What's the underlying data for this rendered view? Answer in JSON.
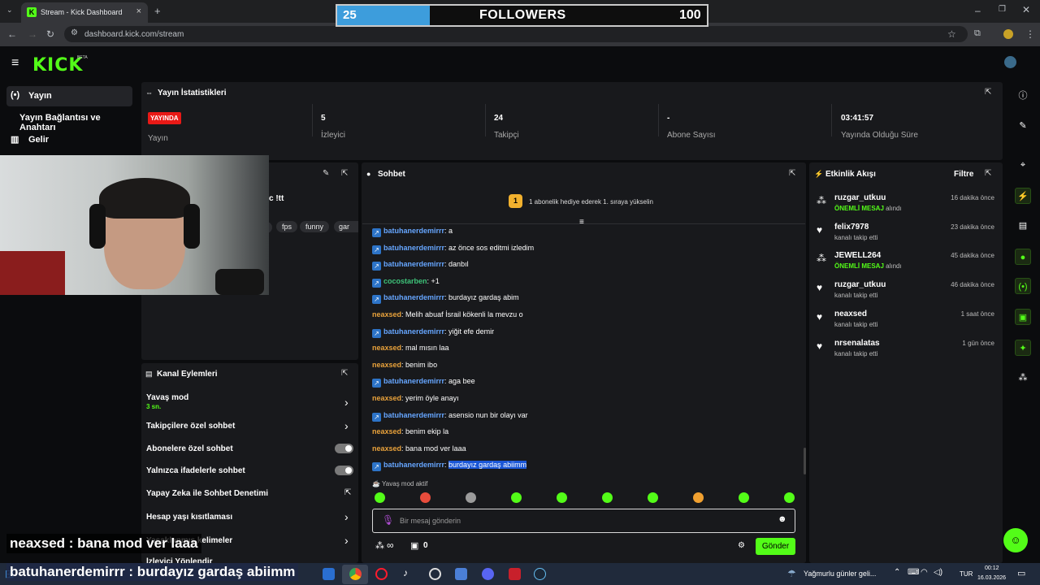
{
  "browser": {
    "tab_title": "Stream - Kick Dashboard",
    "url": "dashboard.kick.com/stream"
  },
  "followers_goal": {
    "current": "25",
    "title": "FOLLOWERS",
    "goal": "100",
    "progress": 0.25,
    "fill_color": "#3d9ddc"
  },
  "brand": {
    "logo": "KICK",
    "beta": "BETA",
    "accent": "#53fc18"
  },
  "sidebar": {
    "items": [
      {
        "label": "Yayın",
        "icon": "broadcast-icon"
      },
      {
        "label": "Yayın Bağlantısı ve Anahtarı",
        "icon": ""
      },
      {
        "label": "Gelir",
        "icon": "chart-icon"
      }
    ]
  },
  "stats": {
    "title": "Yayın İstatistikleri",
    "live_badge": "YAYINDA",
    "status_label": "Yayın",
    "viewers": "5",
    "viewers_label": "İzleyici",
    "followers": "24",
    "followers_label": "Takipçi",
    "subs": "-",
    "subs_label": "Abone Sayısı",
    "uptime": "03:41:57",
    "uptime_label": "Yayında Olduğu Süre"
  },
  "stream_info": {
    "title_fragment": "c !tt",
    "tags": [
      "fps",
      "funny",
      "gar"
    ]
  },
  "chat": {
    "title": "Sohbet",
    "gift_prompt": "1 abonelik hediye ederek 1. sıraya yükselin",
    "gift_rank": "1",
    "messages": [
      {
        "user": "batuhanerdemirrr",
        "text": "a",
        "badge": true
      },
      {
        "user": "batuhanerdemirrr",
        "text": "az önce sos editmi izledim",
        "badge": true
      },
      {
        "user": "batuhanerdemirrr",
        "text": "danbıl",
        "badge": true
      },
      {
        "user": "cocostarben",
        "text": "+1",
        "badge": true,
        "green": true
      },
      {
        "user": "batuhanerdemirrr",
        "text": "burdayız gardaş abim",
        "badge": true
      },
      {
        "user": "neaxsed",
        "text": "Melih abuaf İsrail kökenli la mevzu o",
        "badge": false
      },
      {
        "user": "batuhanerdemirrr",
        "text": "yiğit efe demir",
        "badge": true
      },
      {
        "user": "neaxsed",
        "text": "mal mısın laa",
        "badge": false
      },
      {
        "user": "neaxsed",
        "text": "benim ibo",
        "badge": false
      },
      {
        "user": "batuhanerdemirrr",
        "text": "aga bee",
        "badge": true
      },
      {
        "user": "neaxsed",
        "text": "yerim öyle anayı",
        "badge": false
      },
      {
        "user": "batuhanerdemirrr",
        "text": "asensio nun bir olayı var",
        "badge": true
      },
      {
        "user": "neaxsed",
        "text": "benim ekip la",
        "badge": false
      },
      {
        "user": "neaxsed",
        "text": "bana mod ver laaa",
        "badge": false
      },
      {
        "user": "batuhanerdemirrr",
        "text": "burdayız gardaş abiimm",
        "badge": true,
        "selected": true
      }
    ],
    "slow_mode_notice": "Yavaş mod aktif",
    "input_placeholder": "Bir mesaj gönderin",
    "points": "∞",
    "gifts": "0",
    "send_label": "Gönder"
  },
  "channel_actions": {
    "title": "Kanal Eylemleri",
    "items": [
      {
        "label": "Yavaş mod",
        "sub": "3 sn.",
        "control": "arrow"
      },
      {
        "label": "Takipçilere özel sohbet",
        "control": "arrow"
      },
      {
        "label": "Abonelere özel sohbet",
        "control": "toggle"
      },
      {
        "label": "Yalnızca ifadelerle sohbet",
        "control": "toggle"
      },
      {
        "label": "Yapay Zeka ile Sohbet Denetimi",
        "control": "external"
      },
      {
        "label": "Hesap yaşı kısıtlaması",
        "control": "arrow"
      },
      {
        "label": "Yasaklanmış kelimeler",
        "control": "arrow"
      },
      {
        "label": "İzleyici Yönlendir",
        "control": "none"
      }
    ]
  },
  "activity": {
    "title": "Etkinlik Akışı",
    "filter_label": "Filtre",
    "events": [
      {
        "name": "ruzgar_utkuu",
        "desc_highlight": "ÖNEMLİ MESAJ",
        "desc": "alındı",
        "time": "16 dakika önce",
        "icon": "people-icon"
      },
      {
        "name": "felix7978",
        "desc_highlight": "",
        "desc": "kanalı takip etti",
        "time": "23 dakika önce",
        "icon": "heart-icon"
      },
      {
        "name": "JEWELL264",
        "desc_highlight": "ÖNEMLİ MESAJ",
        "desc": "alındı",
        "time": "45 dakika önce",
        "icon": "people-icon"
      },
      {
        "name": "ruzgar_utkuu",
        "desc_highlight": "",
        "desc": "kanalı takip etti",
        "time": "46 dakika önce",
        "icon": "heart-icon"
      },
      {
        "name": "neaxsed",
        "desc_highlight": "",
        "desc": "kanalı takip etti",
        "time": "1 saat önce",
        "icon": "heart-icon"
      },
      {
        "name": "nrsenalatas",
        "desc_highlight": "",
        "desc": "kanalı takip etti",
        "time": "1 gün önce",
        "icon": "heart-icon"
      }
    ]
  },
  "overlay": {
    "line1_user": "neaxsed",
    "line1_text": " : bana mod ver laaa",
    "line2_user": "batuhanerdemirrr",
    "line2_text": " : burdayız gardaş abiimm"
  },
  "taskbar": {
    "weather": "Yağmurlu günler geli...",
    "lang": "TUR",
    "time": "00:12",
    "date": "16.03.2026"
  }
}
